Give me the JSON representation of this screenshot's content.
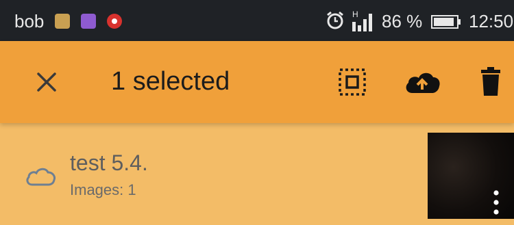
{
  "status_bar": {
    "carrier": "bob",
    "battery_level": "86 %",
    "time": "12:50",
    "network_type": "H",
    "icons": [
      "app-notification-icon",
      "app-notification-icon",
      "record-icon",
      "alarm-icon",
      "signal-icon",
      "battery-icon"
    ]
  },
  "app_bar": {
    "title": "1 selected",
    "background_color": "#f0a03a",
    "icons": [
      "close-icon",
      "select-all-icon",
      "cloud-upload-icon",
      "delete-icon"
    ]
  },
  "list": {
    "items": [
      {
        "title": "test 5.4.",
        "subtitle": "Images: 1",
        "selected": true,
        "background_color": "#f3bc67",
        "status_icon": "cloud-icon",
        "menu_icon": "more-vertical-icon"
      }
    ]
  }
}
